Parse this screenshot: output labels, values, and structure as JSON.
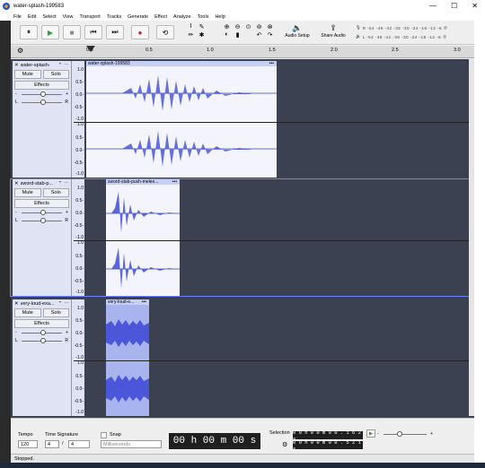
{
  "window": {
    "title": "water-splash-199583",
    "min": "—",
    "max": "☐",
    "close": "✕"
  },
  "menu": [
    "File",
    "Edit",
    "Select",
    "View",
    "Transport",
    "Tracks",
    "Generate",
    "Effect",
    "Analyze",
    "Tools",
    "Help"
  ],
  "toolbar": {
    "pause": "⏸",
    "play": "▶",
    "stop": "■",
    "skip_start": "⏮",
    "skip_end": "⏭",
    "record": "●",
    "loop": "⟲",
    "audio_setup": "Audio Setup",
    "share_audio": "Share Audio",
    "meter_scale": "-54 -48 -42 -36 -30 -24 -18 -12 -6",
    "meter_l": "L",
    "meter_r": "R"
  },
  "ruler": {
    "ticks": [
      "0.0",
      "0.5",
      "1.0",
      "1.5",
      "2.0",
      "2.5",
      "3.0"
    ]
  },
  "tracks": [
    {
      "name": "water-splash-",
      "clip": "water-splash-199583",
      "mute": "Mute",
      "solo": "Solo",
      "effects": "Effects",
      "selected": false
    },
    {
      "name": "sword-stab-p...",
      "clip": "sword-stab-push-melee...",
      "mute": "Mute",
      "solo": "Solo",
      "effects": "Effects",
      "selected": true
    },
    {
      "name": "very-loud-exa...",
      "clip": "very-loud-e...",
      "mute": "Mute",
      "solo": "Solo",
      "effects": "Effects",
      "selected": false
    }
  ],
  "scale_labels": [
    "1.0",
    "0.5-",
    "0.0-",
    "-0.5-",
    "-1.0"
  ],
  "bottom": {
    "tempo_label": "Tempo",
    "tempo": "120",
    "time_sig_label": "Time Signature",
    "ts_num": "4",
    "ts_den": "4",
    "snap_label": "Snap",
    "snap_unit": "Milliseconds",
    "time": "00 h 00 m 00 s",
    "selection_label": "Selection",
    "sel_start": "0 0 h 0 0 m 0 0 . 1 6 2 s",
    "sel_end": "0 0 h 0 0 m 0 0 . 5 2 1 s"
  },
  "status": "Stopped."
}
